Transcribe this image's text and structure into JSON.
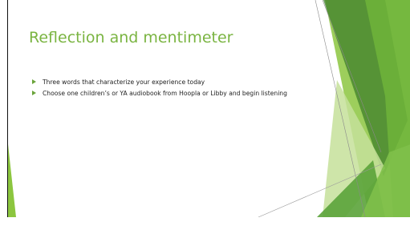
{
  "slide": {
    "title": "Reflection and mentimeter",
    "bullets": [
      "Three words that characterize your experience today",
      "Choose one children’s or YA audiobook from Hoopla or Libby and begin listening"
    ]
  },
  "colors": {
    "title": "#7ab441",
    "bullet_marker": "#6aa33a",
    "accent_dark_green": "#3f7f2a",
    "accent_green": "#6eb43a",
    "accent_light_green": "#c6e19a"
  }
}
